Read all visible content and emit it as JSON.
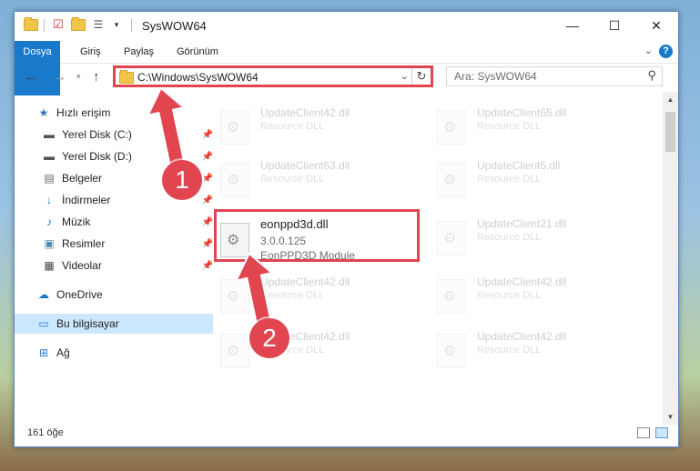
{
  "window": {
    "title": "SysWOW64",
    "controls": {
      "minimize": "—",
      "maximize": "☐",
      "close": "✕"
    }
  },
  "ribbon": {
    "tabs": [
      "Dosya",
      "Giriş",
      "Paylaş",
      "Görünüm"
    ],
    "help_icon": "?"
  },
  "navigation": {
    "address": "C:\\Windows\\SysWOW64",
    "search_placeholder": "Ara: SysWOW64"
  },
  "sidebar": {
    "items": [
      {
        "label": "Hızlı erişim",
        "icon": "star-icon"
      },
      {
        "label": "Yerel Disk (C:)",
        "icon": "drive-icon",
        "pinned": true
      },
      {
        "label": "Yerel Disk (D:)",
        "icon": "drive-icon",
        "pinned": true
      },
      {
        "label": "Belgeler",
        "icon": "document-icon",
        "pinned": true
      },
      {
        "label": "İndirmeler",
        "icon": "download-icon",
        "pinned": true
      },
      {
        "label": "Müzik",
        "icon": "music-icon",
        "pinned": true
      },
      {
        "label": "Resimler",
        "icon": "pictures-icon",
        "pinned": true
      },
      {
        "label": "Videolar",
        "icon": "video-icon",
        "pinned": true
      },
      {
        "label": "OneDrive",
        "icon": "cloud-icon"
      },
      {
        "label": "Bu bilgisayar",
        "icon": "computer-icon",
        "selected": true
      },
      {
        "label": "Ağ",
        "icon": "network-icon"
      }
    ]
  },
  "files": {
    "left": [
      {
        "name": "UpdateClient42.dll",
        "desc": "Resource DLL"
      },
      {
        "name": "UpdateClient63.dll",
        "desc": "Resource DLL"
      },
      {
        "name": "eonppd3d.dll",
        "version": "3.0.0.125",
        "desc": "EonPPD3D Module"
      },
      {
        "name": "UpdateClient42.dll",
        "desc": "Resource DLL"
      },
      {
        "name": "UpdateClient42.dll",
        "desc": "Resource DLL"
      }
    ],
    "right": [
      {
        "name": "UpdateClient65.dll",
        "desc": "Resource DLL"
      },
      {
        "name": "UpdateClient5.dll",
        "desc": "Resource DLL"
      },
      {
        "name": "UpdateClient21.dll",
        "desc": "Resource DLL"
      },
      {
        "name": "UpdateClient42.dll",
        "desc": "Resource DLL"
      },
      {
        "name": "UpdateClient42.dll",
        "desc": "Resource DLL"
      }
    ]
  },
  "status": {
    "item_count": "161 öğe"
  },
  "annotations": {
    "step1": "1",
    "step2": "2"
  },
  "colors": {
    "accent": "#1979ca",
    "highlight": "#e04550",
    "selected": "#cce8ff"
  }
}
